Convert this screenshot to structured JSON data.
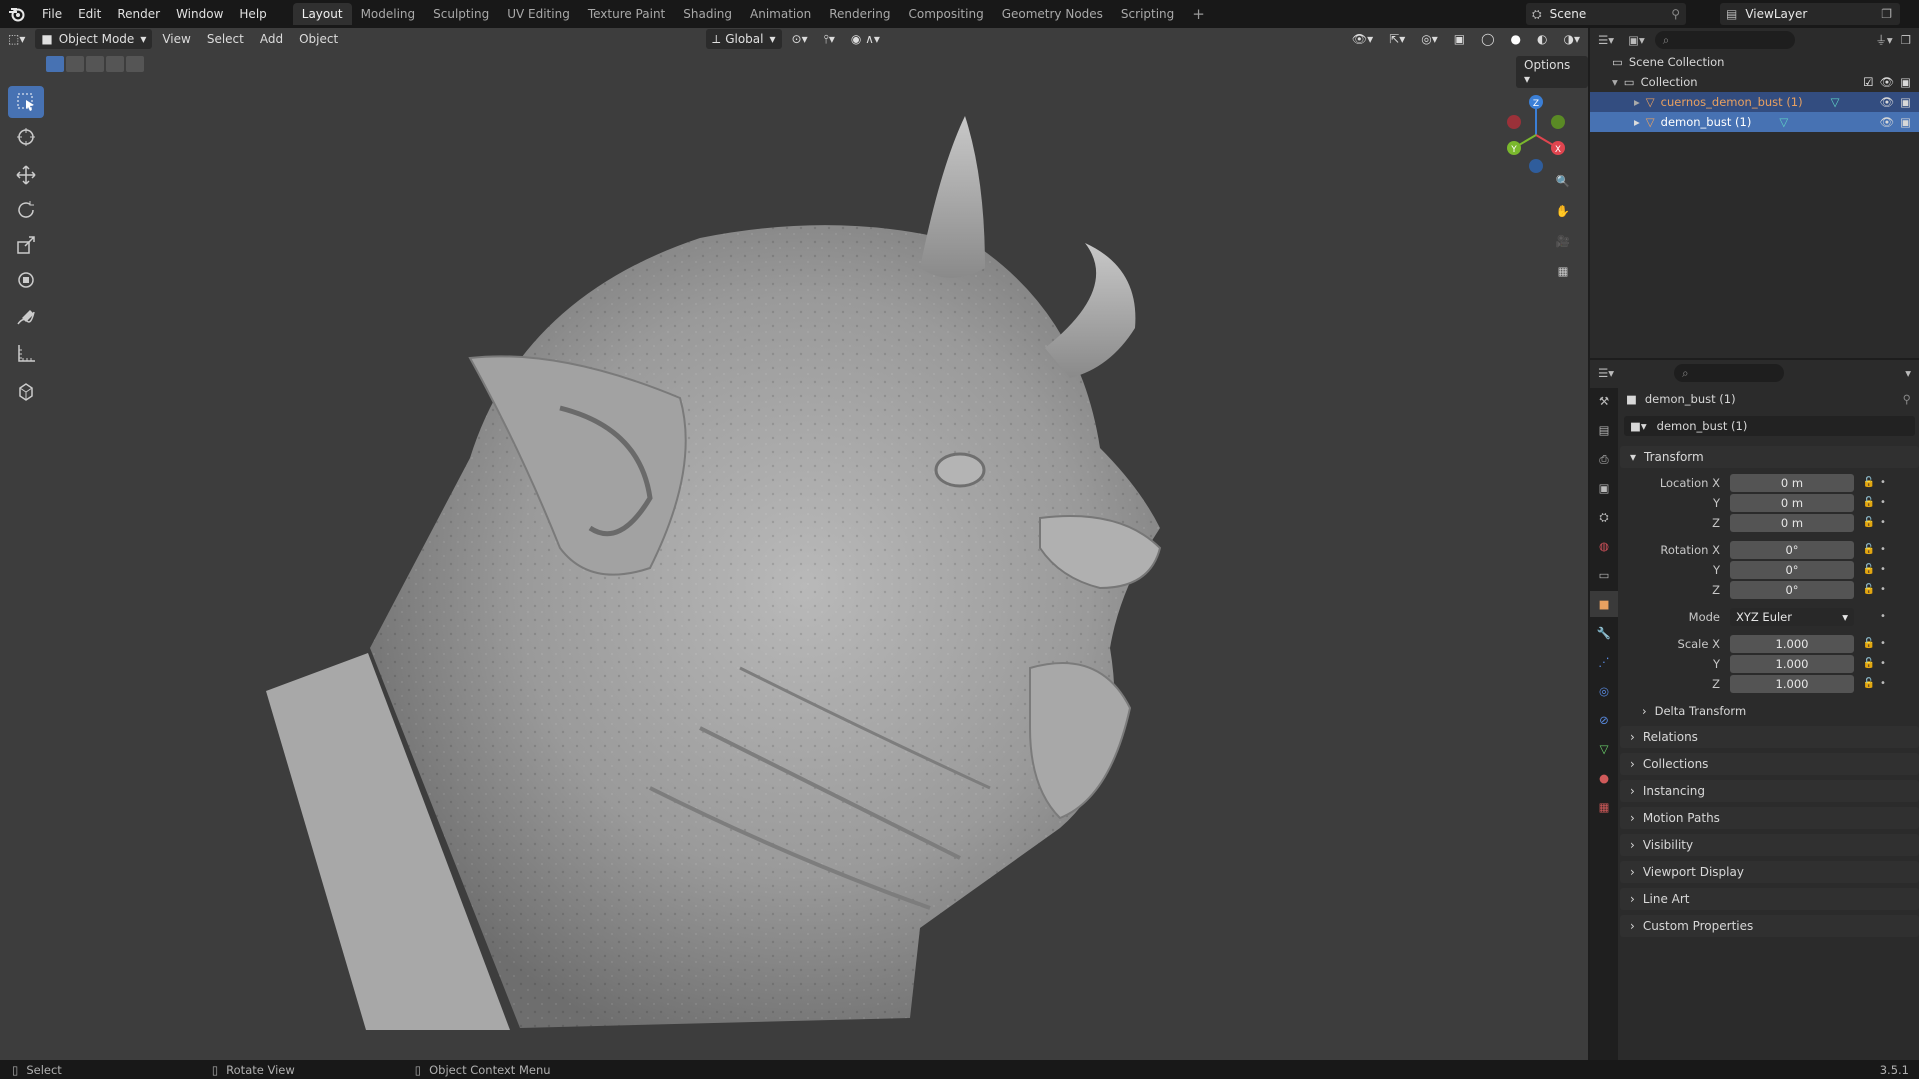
{
  "menu": [
    "File",
    "Edit",
    "Render",
    "Window",
    "Help"
  ],
  "workspaces": [
    "Layout",
    "Modeling",
    "Sculpting",
    "UV Editing",
    "Texture Paint",
    "Shading",
    "Animation",
    "Rendering",
    "Compositing",
    "Geometry Nodes",
    "Scripting"
  ],
  "active_workspace": "Layout",
  "scene_name": "Scene",
  "view_layer": "ViewLayer",
  "viewport": {
    "mode": "Object Mode",
    "menus": [
      "View",
      "Select",
      "Add",
      "Object"
    ],
    "orientation": "Global",
    "options_label": "Options",
    "gizmo_axes": {
      "x": "X",
      "y": "Y",
      "z": "Z"
    }
  },
  "outliner": {
    "scene_collection": "Scene Collection",
    "collection": "Collection",
    "items": [
      {
        "name": "cuernos_demon_bust (1)",
        "selected": true,
        "color": "#e8a060"
      },
      {
        "name": "demon_bust (1)",
        "selected": true,
        "color": "#ffffff"
      }
    ]
  },
  "properties": {
    "object_name": "demon_bust (1)",
    "datablock_name": "demon_bust (1)",
    "transform_label": "Transform",
    "location_label": "Location X",
    "rotation_label": "Rotation X",
    "scale_label": "Scale X",
    "y_label": "Y",
    "z_label": "Z",
    "mode_label": "Mode",
    "location": [
      "0 m",
      "0 m",
      "0 m"
    ],
    "rotation": [
      "0°",
      "0°",
      "0°"
    ],
    "mode_value": "XYZ Euler",
    "scale": [
      "1.000",
      "1.000",
      "1.000"
    ],
    "delta_transform": "Delta Transform",
    "panels": [
      "Relations",
      "Collections",
      "Instancing",
      "Motion Paths",
      "Visibility",
      "Viewport Display",
      "Line Art",
      "Custom Properties"
    ]
  },
  "status": {
    "select": "Select",
    "rotate": "Rotate View",
    "context": "Object Context Menu",
    "version": "3.5.1"
  },
  "colors": {
    "accent": "#4772b3",
    "selection": "#334d80",
    "viewport_bg": "#3d3d3d",
    "axis_x": "#e0454f",
    "axis_y": "#7ab82d",
    "axis_z": "#3b7fd6"
  }
}
